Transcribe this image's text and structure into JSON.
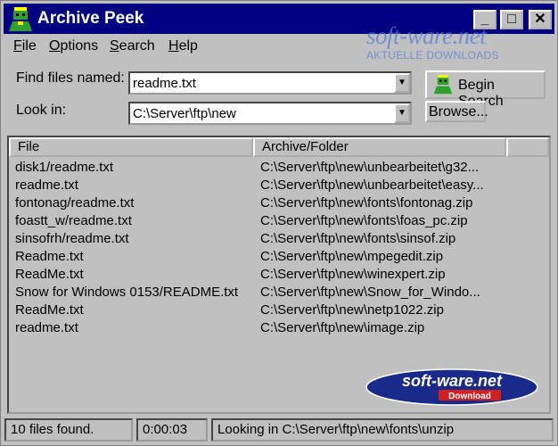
{
  "window": {
    "title": "Archive Peek"
  },
  "menu": [
    {
      "accel": "F",
      "rest": "ile"
    },
    {
      "accel": "O",
      "rest": "ptions"
    },
    {
      "accel": "S",
      "rest": "earch"
    },
    {
      "accel": "H",
      "rest": "elp"
    }
  ],
  "watermark": {
    "top": "soft-ware.net",
    "top_sub": "AKTUELLE DOWNLOADS",
    "logo": "soft-ware.net",
    "logo_sub": "Download"
  },
  "form": {
    "find_label": "Find files named:",
    "find_value": "readme.txt",
    "lookin_label": "Look in:",
    "lookin_value": "C:\\Server\\ftp\\new",
    "begin_search": "Begin Search",
    "browse": "Browse..."
  },
  "list": {
    "columns": [
      "File",
      "Archive/Folder"
    ],
    "rows": [
      {
        "file": "disk1/readme.txt",
        "archive": "C:\\Server\\ftp\\new\\unbearbeitet\\g32..."
      },
      {
        "file": "readme.txt",
        "archive": "C:\\Server\\ftp\\new\\unbearbeitet\\easy..."
      },
      {
        "file": "fontonag/readme.txt",
        "archive": "C:\\Server\\ftp\\new\\fonts\\fontonag.zip"
      },
      {
        "file": "foastt_w/readme.txt",
        "archive": "C:\\Server\\ftp\\new\\fonts\\foas_pc.zip"
      },
      {
        "file": "sinsofrh/readme.txt",
        "archive": "C:\\Server\\ftp\\new\\fonts\\sinsof.zip"
      },
      {
        "file": "Readme.txt",
        "archive": "C:\\Server\\ftp\\new\\mpegedit.zip"
      },
      {
        "file": "ReadMe.txt",
        "archive": "C:\\Server\\ftp\\new\\winexpert.zip"
      },
      {
        "file": "Snow for Windows 0153/README.txt",
        "archive": "C:\\Server\\ftp\\new\\Snow_for_Windo..."
      },
      {
        "file": "ReadMe.txt",
        "archive": "C:\\Server\\ftp\\new\\netp1022.zip"
      },
      {
        "file": "readme.txt",
        "archive": "C:\\Server\\ftp\\new\\image.zip"
      }
    ]
  },
  "status": {
    "found": "10 files found.",
    "elapsed": "0:00:03",
    "looking": "Looking in C:\\Server\\ftp\\new\\fonts\\unzip"
  },
  "colors": {
    "titlebar": "#000080",
    "face": "#c0c0c0",
    "watermark": "#5a7ed8",
    "logo_bg": "#1a2a8a",
    "logo_accent": "#d02020"
  },
  "icons": {
    "app": "green-robot-icon",
    "minimize": "minimize-icon",
    "maximize": "maximize-icon",
    "close": "close-icon",
    "dropdown": "dropdown-arrow-icon"
  }
}
